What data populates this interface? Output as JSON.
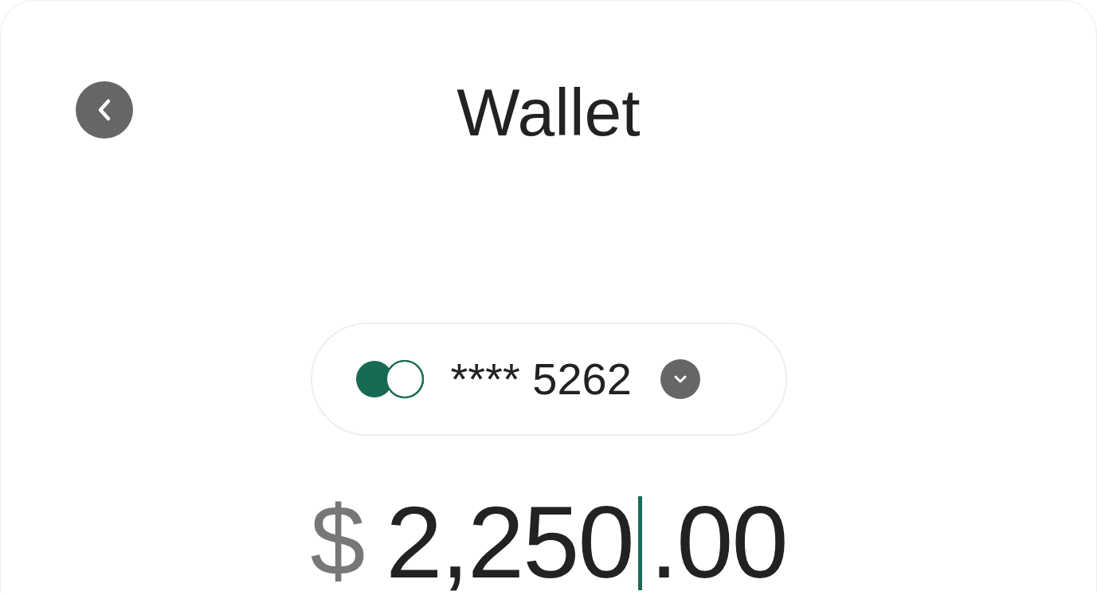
{
  "title": "Wallet",
  "card": {
    "masked_number": "**** 5262"
  },
  "amount": {
    "currency": "$",
    "whole": "2,250",
    "fraction": ".00"
  }
}
